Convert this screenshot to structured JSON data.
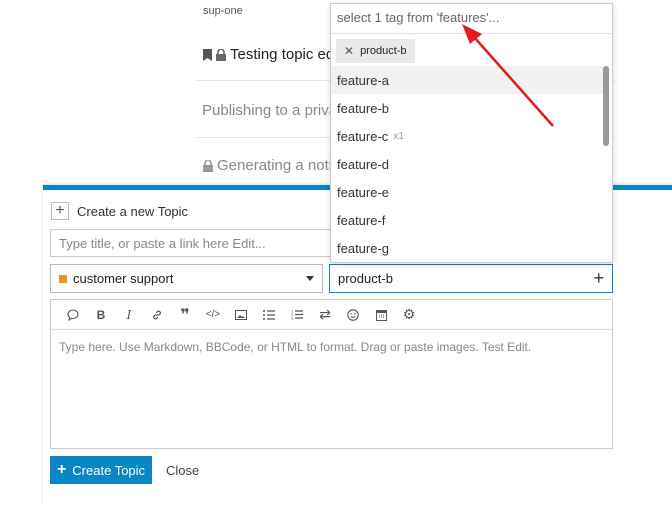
{
  "background": {
    "meta_text": "sup-one",
    "topics": [
      {
        "title": "Testing topic edi"
      },
      {
        "title": "Publishing to a priva"
      },
      {
        "title": "Generating a notifi"
      }
    ]
  },
  "composer": {
    "header": "Create a new Topic",
    "title_placeholder": "Type title, or paste a link here Edit...",
    "category": "customer support",
    "category_color": "#f0941e",
    "tag_value": "product-b",
    "editor_placeholder": "Type here. Use Markdown, BBCode, or HTML to format. Drag or paste images. Test Edit.",
    "toolbar": [
      {
        "name": "quote-icon",
        "glyph": "💬"
      },
      {
        "name": "bold-icon",
        "glyph": "B"
      },
      {
        "name": "italic-icon",
        "glyph": "I"
      },
      {
        "name": "link-icon",
        "glyph": "🔗"
      },
      {
        "name": "blockquote-icon",
        "glyph": "❝"
      },
      {
        "name": "code-icon",
        "glyph": "</>"
      },
      {
        "name": "image-icon",
        "glyph": "▭"
      },
      {
        "name": "bullet-list-icon",
        "glyph": "☰"
      },
      {
        "name": "numbered-list-icon",
        "glyph": "☷"
      },
      {
        "name": "rtl-icon",
        "glyph": "⇄"
      },
      {
        "name": "emoji-icon",
        "glyph": "☺"
      },
      {
        "name": "calendar-icon",
        "glyph": "▦"
      },
      {
        "name": "gear-icon",
        "glyph": "⚙"
      }
    ],
    "create_label": "Create Topic",
    "close_label": "Close",
    "accent": "#0a85c6"
  },
  "tag_dropdown": {
    "filter_placeholder": "select 1 tag from 'features'...",
    "selected_chip": "product-b",
    "items": [
      {
        "label": "feature-a",
        "count": ""
      },
      {
        "label": "feature-b",
        "count": ""
      },
      {
        "label": "feature-c",
        "count": "x1"
      },
      {
        "label": "feature-d",
        "count": ""
      },
      {
        "label": "feature-e",
        "count": ""
      },
      {
        "label": "feature-f",
        "count": ""
      },
      {
        "label": "feature-g",
        "count": ""
      }
    ]
  }
}
